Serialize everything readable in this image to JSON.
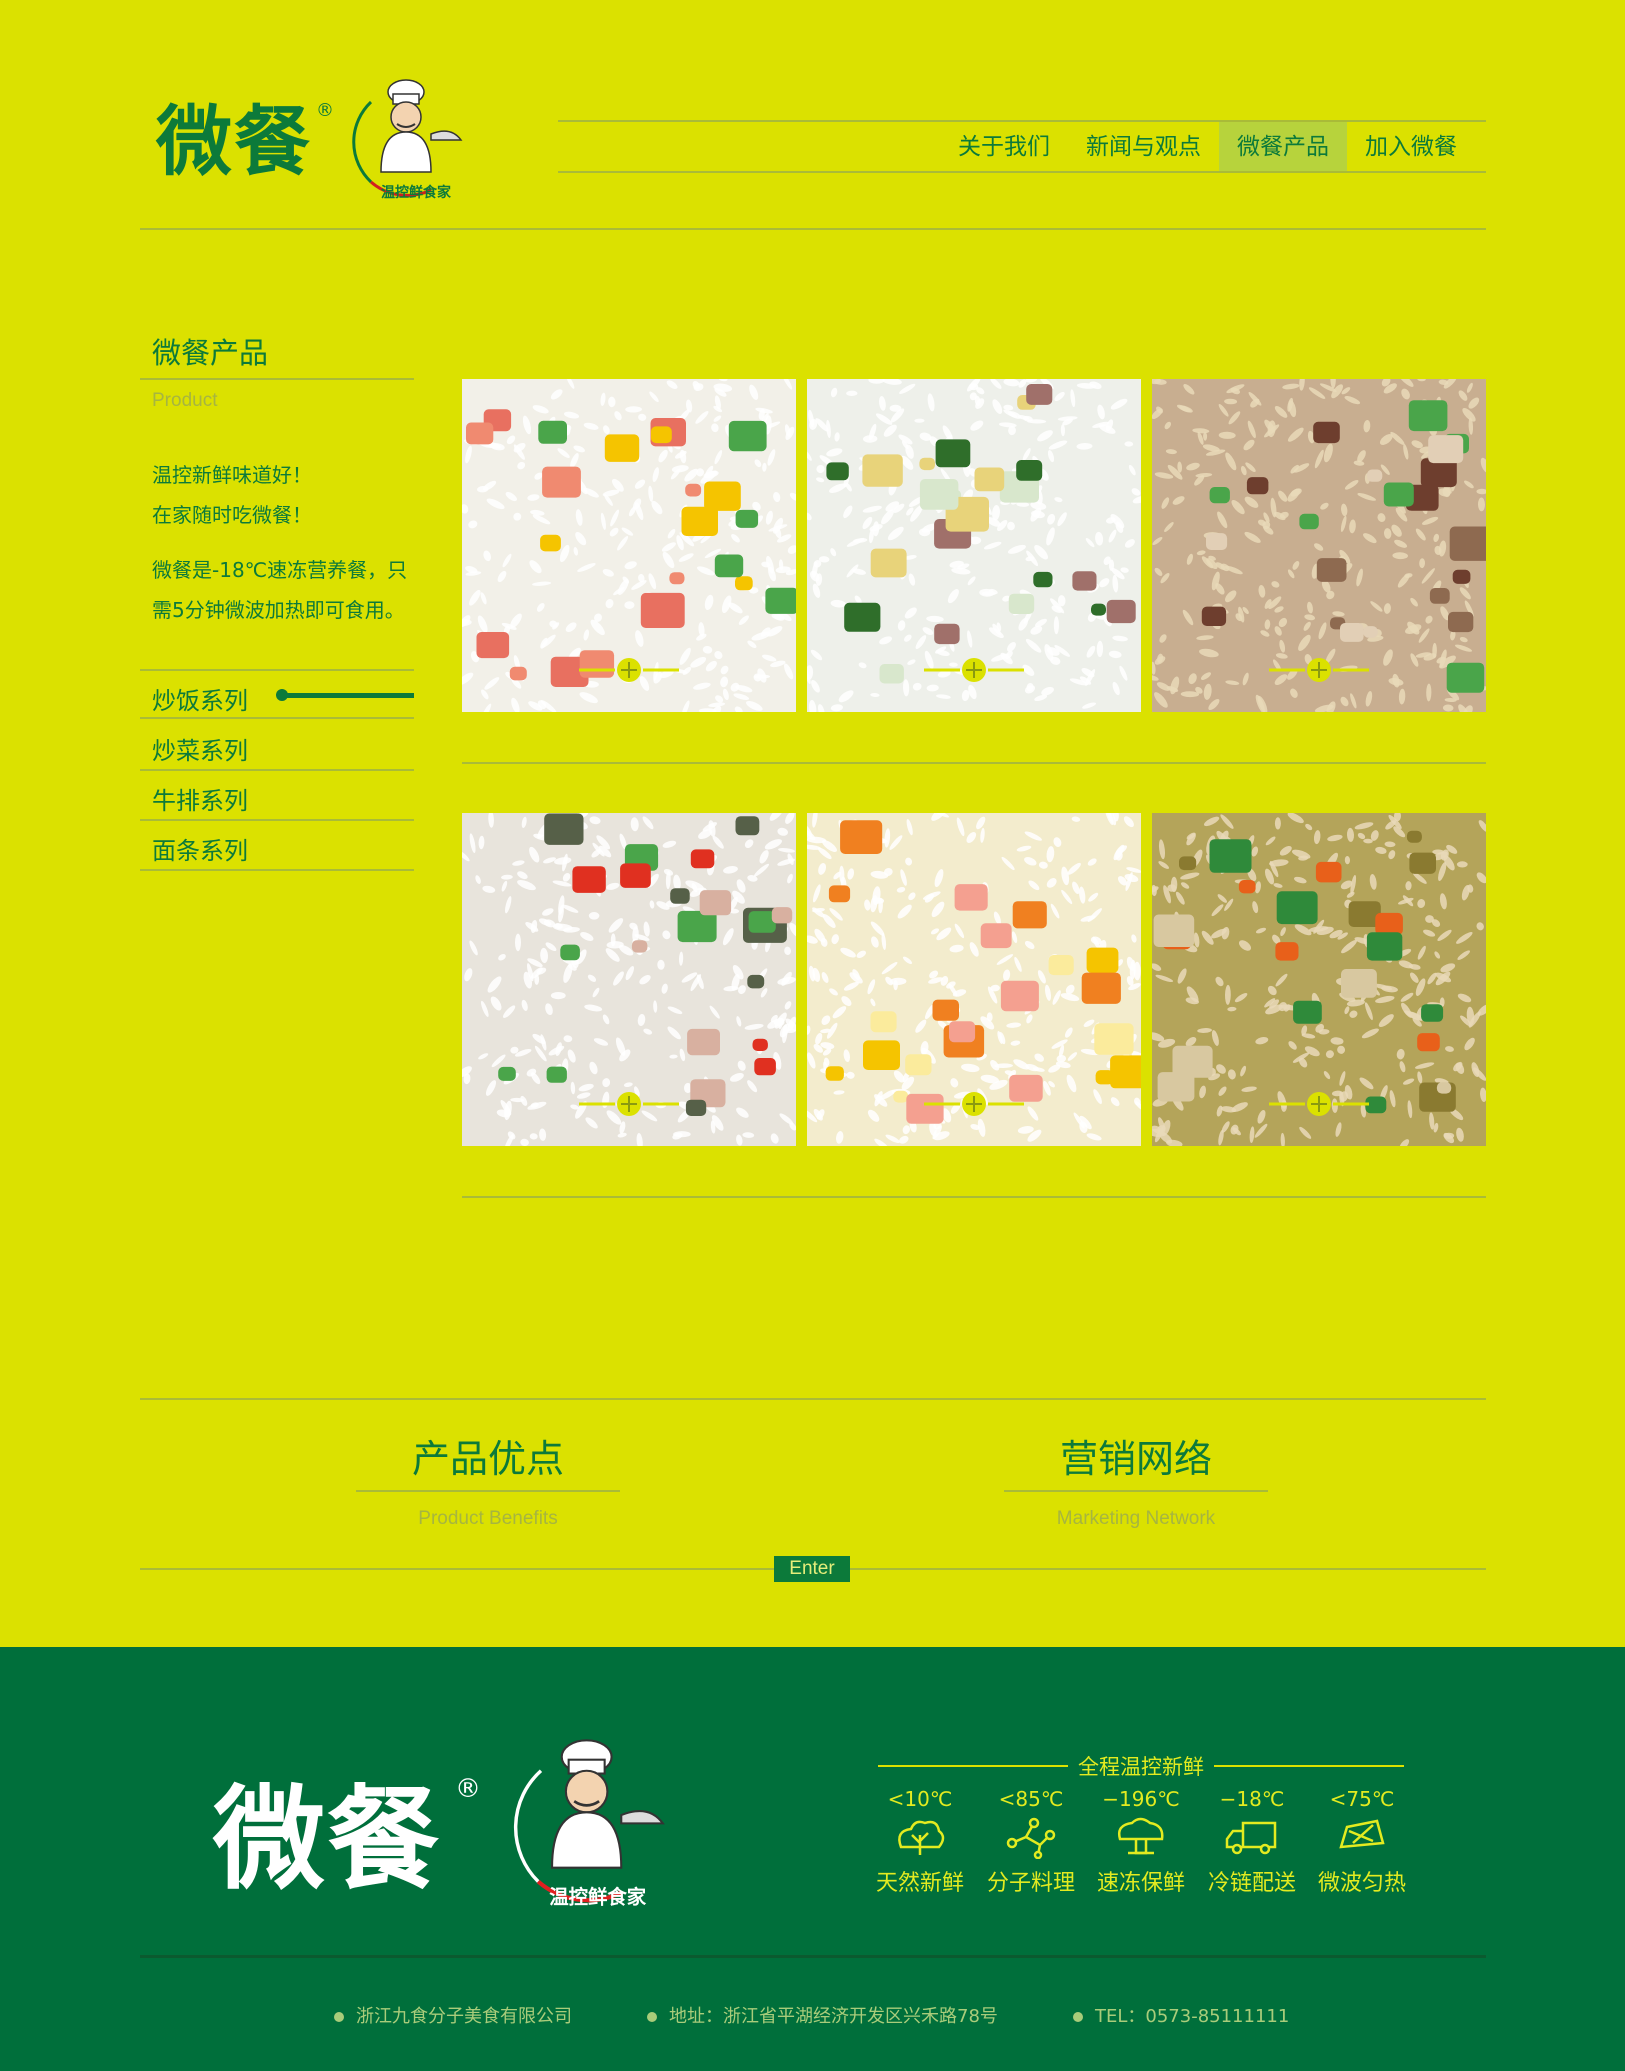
{
  "header": {
    "logo_text": "微餐",
    "logo_reg": "®",
    "nav": [
      {
        "label": "关于我们",
        "active": false
      },
      {
        "label": "新闻与观点",
        "active": false
      },
      {
        "label": "微餐产品",
        "active": true
      },
      {
        "label": "加入微餐",
        "active": false
      }
    ]
  },
  "sidebar": {
    "title": "微餐产品",
    "subtitle": "Product",
    "desc_line1": "温控新鲜味道好！",
    "desc_line2": "在家随时吃微餐！",
    "desc_line3": "微餐是-18℃速冻营养餐，只",
    "desc_line4": "需5分钟微波加热即可食用。",
    "categories": [
      {
        "label": "炒饭系列",
        "selected": true
      },
      {
        "label": "炒菜系列",
        "selected": false
      },
      {
        "label": "牛排系列",
        "selected": false
      },
      {
        "label": "面条系列",
        "selected": false
      }
    ]
  },
  "products": [
    {
      "name": "fried-rice-ham-corn"
    },
    {
      "name": "fried-rice-vegetable-meat"
    },
    {
      "name": "fried-rice-soy-pork"
    },
    {
      "name": "fried-rice-pickled-greens"
    },
    {
      "name": "fried-rice-shrimp-egg"
    },
    {
      "name": "fried-rice-curry"
    }
  ],
  "sections": {
    "benefits_title": "产品优点",
    "benefits_sub": "Product Benefits",
    "network_title": "营销网络",
    "network_sub": "Marketing Network",
    "enter_label": "Enter"
  },
  "footer": {
    "logo_text": "微餐",
    "logo_reg": "®",
    "temp_title": "全程温控新鲜",
    "temps": [
      {
        "temp": "<10℃",
        "label": "天然新鲜",
        "icon": "lettuce-icon"
      },
      {
        "temp": "<85℃",
        "label": "分子料理",
        "icon": "molecule-icon"
      },
      {
        "temp": "−196℃",
        "label": "速冻保鲜",
        "icon": "mushroom-cloud-icon"
      },
      {
        "temp": "−18℃",
        "label": "冷链配送",
        "icon": "truck-icon"
      },
      {
        "temp": "<75℃",
        "label": "微波匀热",
        "icon": "microwave-icon"
      }
    ],
    "company": "浙江九食分子美食有限公司",
    "address": "地址：浙江省平湖经济开发区兴禾路78号",
    "tel": "TEL：0573-85111111"
  },
  "colors": {
    "background": "#dbe100",
    "brand_green": "#0c7a3a",
    "footer_green": "#006f3b",
    "accent_yellow": "#e3eb20"
  }
}
